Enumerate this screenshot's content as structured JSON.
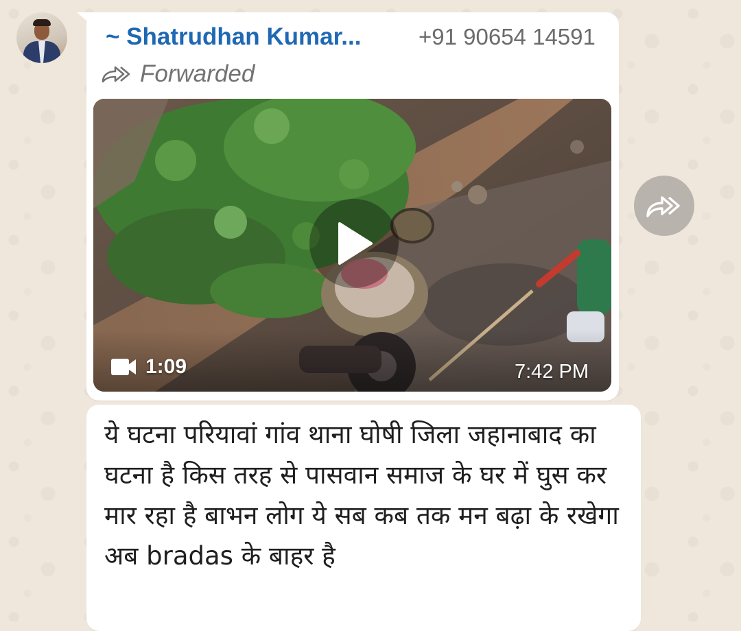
{
  "message": {
    "sender_name": "~ Shatrudhan Kumar...",
    "sender_phone": "+91 90654 14591",
    "forwarded_label": "Forwarded",
    "video_duration": "1:09",
    "video_time": "7:42 PM",
    "text": "ये घटना परियावां गांव थाना घोषी जिला जहानाबाद का घटना है किस तरह से पासवान समाज के घर में घुस कर मार रहा है बाभन लोग ये सब कब तक मन बढ़ा के रखेगा अब bradas के बाहर है"
  },
  "icons": {
    "avatar": "profile-photo",
    "forwarded": "forwarded-arrow-icon",
    "play": "play-icon",
    "video": "video-camera-icon",
    "forward_action": "forward-icon"
  },
  "colors": {
    "sender_name": "#1f68b4",
    "bubble": "#ffffff",
    "wallpaper": "#efe7dc",
    "forward_button": "#b8b3ac"
  }
}
